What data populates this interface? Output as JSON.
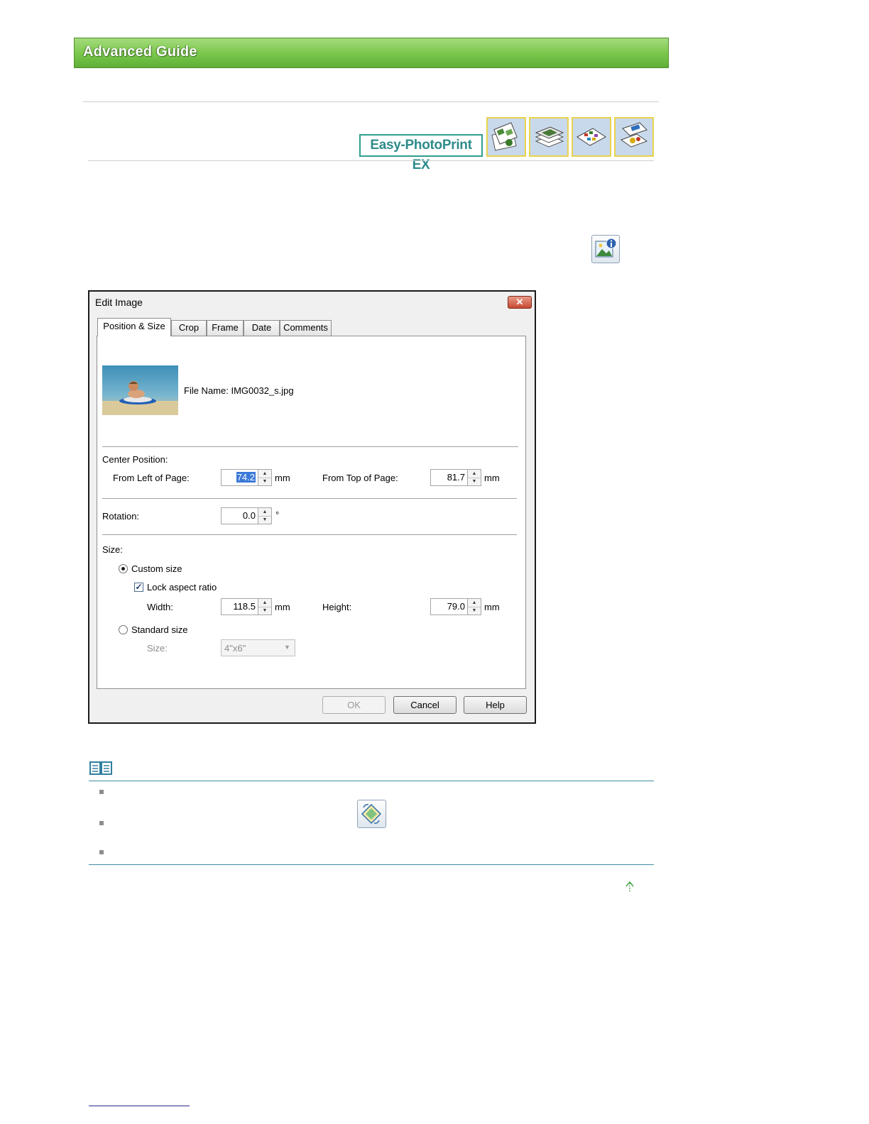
{
  "header": {
    "title": "Advanced Guide"
  },
  "product_logo": "Easy-PhotoPrint EX",
  "nav_icons": [
    "album-icon",
    "photo-print-icon",
    "layout-print-icon",
    "sticker-print-icon"
  ],
  "dialog": {
    "title": "Edit Image",
    "close_label": "✕",
    "tabs": [
      "Position & Size",
      "Crop",
      "Frame",
      "Date",
      "Comments"
    ],
    "file_name": "File Name: IMG0032_s.jpg",
    "center_position": {
      "heading": "Center Position:",
      "left_label": "From Left of Page:",
      "left_value": "74.2",
      "top_label": "From Top of Page:",
      "top_value": "81.7",
      "unit": "mm"
    },
    "rotation": {
      "label": "Rotation:",
      "value": "0.0",
      "unit": "°"
    },
    "size": {
      "heading": "Size:",
      "custom_label": "Custom size",
      "lock_label": "Lock aspect ratio",
      "width_label": "Width:",
      "width_value": "118.5",
      "height_label": "Height:",
      "height_value": "79.0",
      "unit": "mm",
      "standard_label": "Standard size",
      "size_label": "Size:",
      "size_value": "4\"x6\""
    },
    "buttons": {
      "ok": "OK",
      "cancel": "Cancel",
      "help": "Help"
    }
  },
  "colors": {
    "banner_green": "#78c64a",
    "logo_teal": "#2e8b8b",
    "note_rule": "#3f8f9f"
  }
}
